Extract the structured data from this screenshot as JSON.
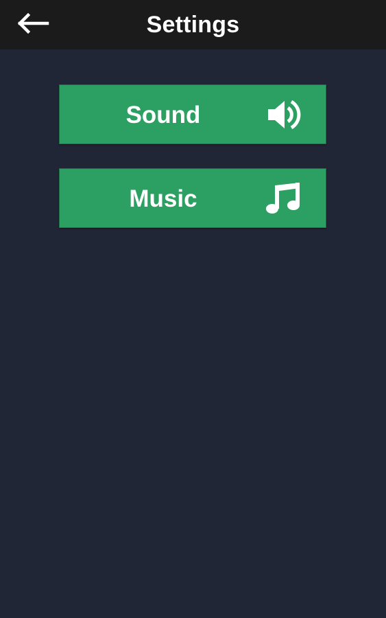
{
  "header": {
    "title": "Settings",
    "back_icon": "back-arrow-icon"
  },
  "settings": {
    "sound_label": "Sound",
    "sound_icon": "speaker-volume-icon",
    "music_label": "Music",
    "music_icon": "music-note-icon"
  },
  "colors": {
    "app_bar": "#1b1b1b",
    "background": "#212637",
    "button": "#2ca062",
    "text": "#ffffff"
  }
}
